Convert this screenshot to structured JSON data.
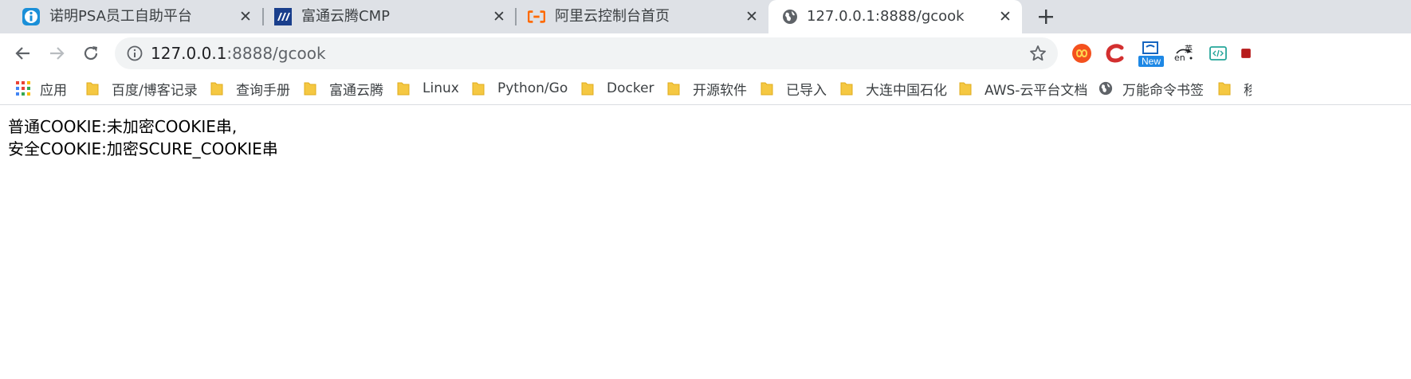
{
  "tabs": [
    {
      "title": "诺明PSA员工自助平台",
      "icon": "info-icon",
      "active": false
    },
    {
      "title": "富通云腾CMP",
      "icon": "ft-logo-icon",
      "active": false
    },
    {
      "title": "阿里云控制台首页",
      "icon": "aliyun-icon",
      "active": false
    },
    {
      "title": "127.0.0.1:8888/gcook",
      "icon": "globe-icon",
      "active": true
    }
  ],
  "address_bar": {
    "host": "127.0.0.1",
    "rest": ":8888/gcook"
  },
  "extensions": {
    "new_badge": "New",
    "translate_label_top": "英",
    "translate_label_bottom": "en"
  },
  "bookmarks": {
    "apps_label": "应用",
    "items": [
      "百度/博客记录",
      "查询手册",
      "富通云腾",
      "Linux",
      "Python/Go",
      "Docker",
      "开源软件",
      "已导入",
      "大连中国石化",
      "AWS-云平台文档",
      "万能命令书签"
    ],
    "overflow_label": "移"
  },
  "page": {
    "line1": "普通COOKIE:未加密COOKIE串,",
    "line2": "安全COOKIE:加密SCURE_COOKIE串"
  },
  "colors": {
    "tabstrip": "#dee1e6",
    "omnibox": "#f1f3f4",
    "folder": "#f5c842",
    "aliyun": "#ff6a00",
    "ft_logo": "#1a3f8c"
  }
}
